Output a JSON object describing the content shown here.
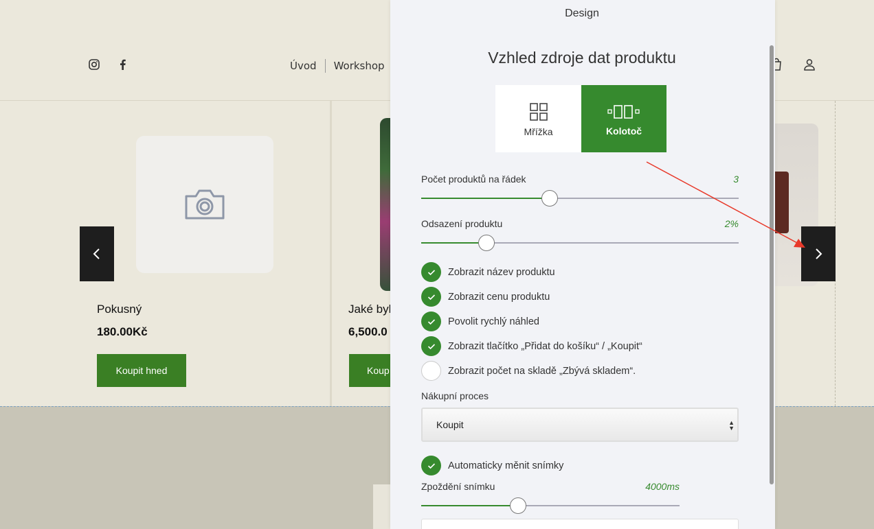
{
  "site": {
    "nav": [
      "Úvod",
      "Workshop"
    ],
    "products": [
      {
        "name": "Pokusný",
        "price": "180.00Kč",
        "button": "Koupit hned"
      },
      {
        "name": "Jaké byl",
        "price": "6,500.0",
        "button": "Koup"
      }
    ]
  },
  "panel": {
    "title": "Design",
    "heading": "Vzhled zdroje dat produktu",
    "layouts": [
      {
        "label": "Mřížka",
        "icon": "grid-icon",
        "selected": false
      },
      {
        "label": "Kolotoč",
        "icon": "carousel-icon",
        "selected": true
      }
    ],
    "sliders": [
      {
        "label": "Počet produktů na řádek",
        "value": "3",
        "fraction": 0.404
      },
      {
        "label": "Odsazení produktu",
        "value": "2%",
        "fraction": 0.204
      }
    ],
    "checkboxes": [
      {
        "label": "Zobrazit název produktu",
        "checked": true
      },
      {
        "label": "Zobrazit cenu produktu",
        "checked": true
      },
      {
        "label": "Povolit rychlý náhled",
        "checked": true
      },
      {
        "label": "Zobrazit tlačítko „Přidat do košíku“ / „Koupit“",
        "checked": true
      },
      {
        "label": "Zobrazit počet na skladě „Zbývá skladem“.",
        "checked": false
      }
    ],
    "purchase": {
      "label": "Nákupní proces",
      "value": "Koupit"
    },
    "autoslide": {
      "label": "Automaticky měnit snímky",
      "checked": true
    },
    "delay": {
      "label": "Zpoždění snímku",
      "value": "4000ms",
      "fraction": 0.37
    }
  },
  "colors": {
    "accent": "#368a2e",
    "buy_button": "#3a7f24",
    "annotation": "#e8392a"
  }
}
